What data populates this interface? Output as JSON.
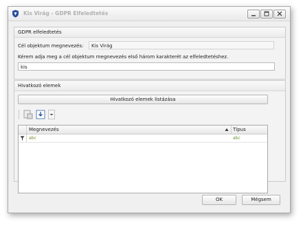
{
  "window": {
    "title": "Kis Virág - GDPR Elfeledtetés"
  },
  "gdpr_group": {
    "header": "GDPR elfeledtetés",
    "target_label": "Cél objektum megnevezés:",
    "target_value": "Kis Virág",
    "instruction": "Kérem adja meg a cél objektum megnevezés első három karakterét az elfeledtetéshez.",
    "input_value": "kis"
  },
  "refs_group": {
    "header": "Hivatkozó elemek",
    "list_button": "Hivatkozó elemek listázása",
    "columns": [
      "Megnevezés",
      "Típus"
    ],
    "filter_glyph": "abc"
  },
  "footer": {
    "ok_label": "OK",
    "cancel_label": "Mégsem"
  },
  "icons": {
    "app": "shield-icon",
    "minimize": "minimize-icon",
    "maximize": "maximize-icon",
    "close": "close-icon",
    "export": "export-icon",
    "save": "save-icon",
    "dropdown": "chevron-down-icon",
    "sort": "sort-up-icon",
    "filter": "filter-icon"
  }
}
